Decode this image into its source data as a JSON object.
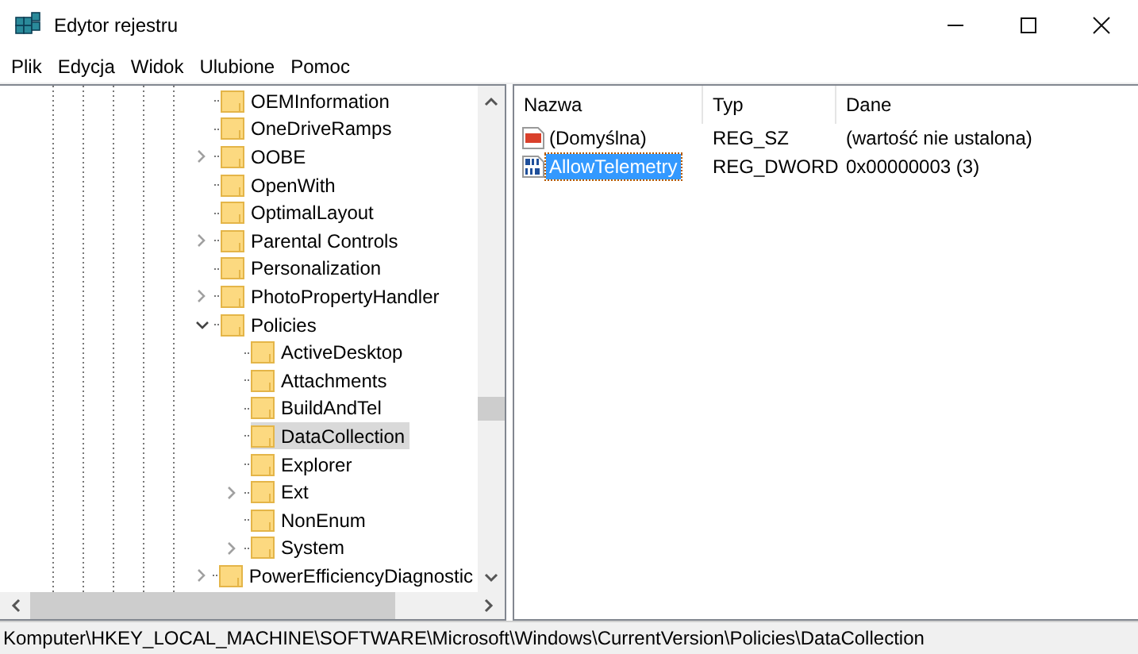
{
  "window": {
    "title": "Edytor rejestru"
  },
  "menu": [
    "Plik",
    "Edycja",
    "Widok",
    "Ulubione",
    "Pomoc"
  ],
  "tree": {
    "items": [
      {
        "label": "OEMInformation",
        "kind": "leaf",
        "selected": false
      },
      {
        "label": "OneDriveRamps",
        "kind": "leaf",
        "selected": false
      },
      {
        "label": "OOBE",
        "kind": "collapsed",
        "selected": false
      },
      {
        "label": "OpenWith",
        "kind": "leaf",
        "selected": false
      },
      {
        "label": "OptimalLayout",
        "kind": "leaf",
        "selected": false
      },
      {
        "label": "Parental Controls",
        "kind": "collapsed",
        "selected": false
      },
      {
        "label": "Personalization",
        "kind": "leaf",
        "selected": false
      },
      {
        "label": "PhotoPropertyHandler",
        "kind": "collapsed",
        "selected": false
      },
      {
        "label": "Policies",
        "kind": "expanded",
        "selected": false,
        "children": [
          {
            "label": "ActiveDesktop",
            "kind": "leaf",
            "selected": false
          },
          {
            "label": "Attachments",
            "kind": "leaf",
            "selected": false
          },
          {
            "label": "BuildAndTel",
            "kind": "leaf",
            "selected": false
          },
          {
            "label": "DataCollection",
            "kind": "leaf",
            "selected": true
          },
          {
            "label": "Explorer",
            "kind": "leaf",
            "selected": false
          },
          {
            "label": "Ext",
            "kind": "collapsed",
            "selected": false
          },
          {
            "label": "NonEnum",
            "kind": "leaf",
            "selected": false
          },
          {
            "label": "System",
            "kind": "collapsed",
            "selected": false
          }
        ]
      },
      {
        "label": "PowerEfficiencyDiagnostic",
        "kind": "collapsed",
        "selected": false
      }
    ]
  },
  "values": {
    "columns": [
      "Nazwa",
      "Typ",
      "Dane"
    ],
    "rows": [
      {
        "name": "(Domyślna)",
        "type": "REG_SZ",
        "data": "(wartość nie ustalona)",
        "kind": "string",
        "selected": false
      },
      {
        "name": "AllowTelemetry",
        "type": "REG_DWORD",
        "data": "0x00000003 (3)",
        "kind": "binary",
        "selected": true
      }
    ]
  },
  "status_bar": "Komputer\\HKEY_LOCAL_MACHINE\\SOFTWARE\\Microsoft\\Windows\\CurrentVersion\\Policies\\DataCollection"
}
